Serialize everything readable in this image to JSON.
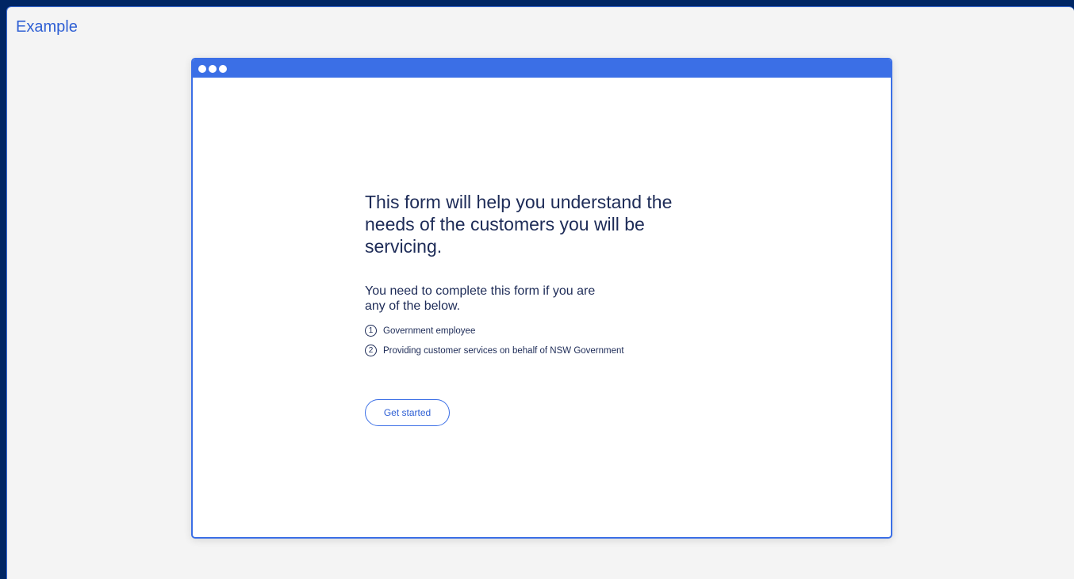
{
  "panel": {
    "label": "Example"
  },
  "colors": {
    "background": "#002664",
    "panel": "#f4f4f4",
    "accent": "#3b6fe6",
    "text": "#1d2b57"
  },
  "browser": {
    "window_controls": [
      "dot",
      "dot",
      "dot"
    ]
  },
  "form_intro": {
    "headline": "This form will help you understand the needs of the customers you will be servicing.",
    "intro": "You need to complete this form if you are any of the below.",
    "items": [
      {
        "number": "1",
        "label": "Government employee"
      },
      {
        "number": "2",
        "label": "Providing customer services on behalf of NSW Government"
      }
    ],
    "button_label": "Get started"
  }
}
